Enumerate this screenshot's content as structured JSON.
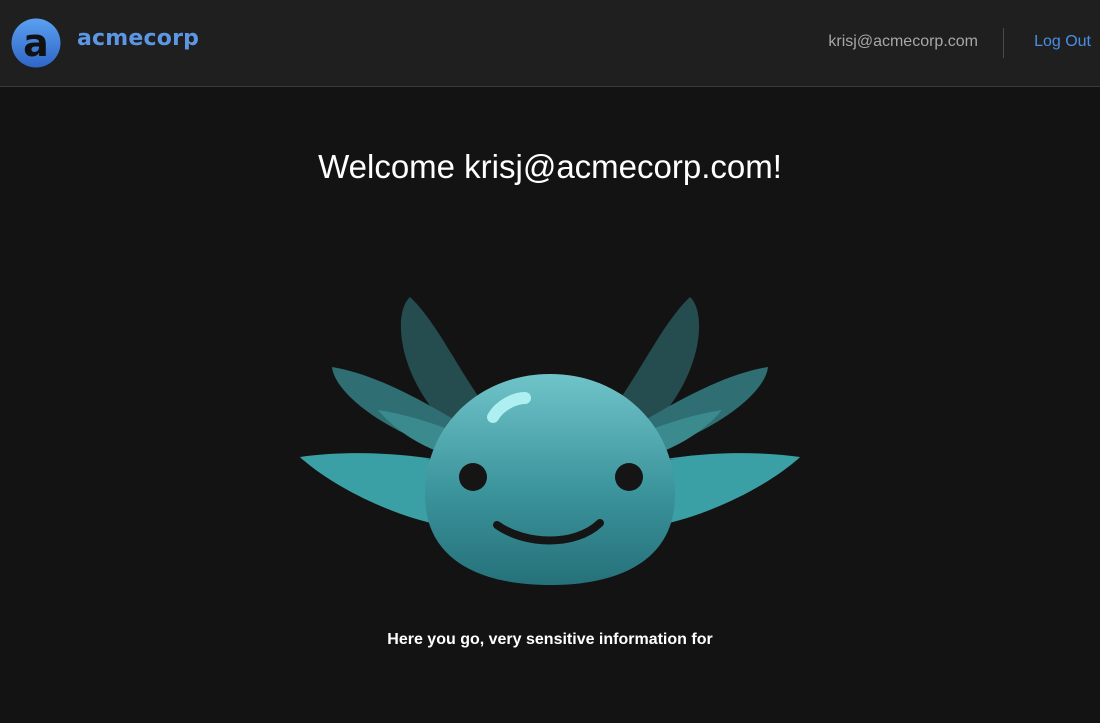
{
  "header": {
    "brand_name": "acmecorp",
    "user_email": "krisj@acmecorp.com",
    "logout_label": "Log Out"
  },
  "main": {
    "welcome_text": "Welcome krisj@acmecorp.com!",
    "info_text": "Here you go, very sensitive information for"
  },
  "colors": {
    "background": "#131313",
    "header_background": "#1f1f1f",
    "brand": "#5c97e6",
    "link": "#4a8ee6",
    "mascot_teal": "#4aa9b0"
  },
  "icons": {
    "logo": "acmecorp-logo-icon",
    "mascot": "axolotl-mascot"
  }
}
